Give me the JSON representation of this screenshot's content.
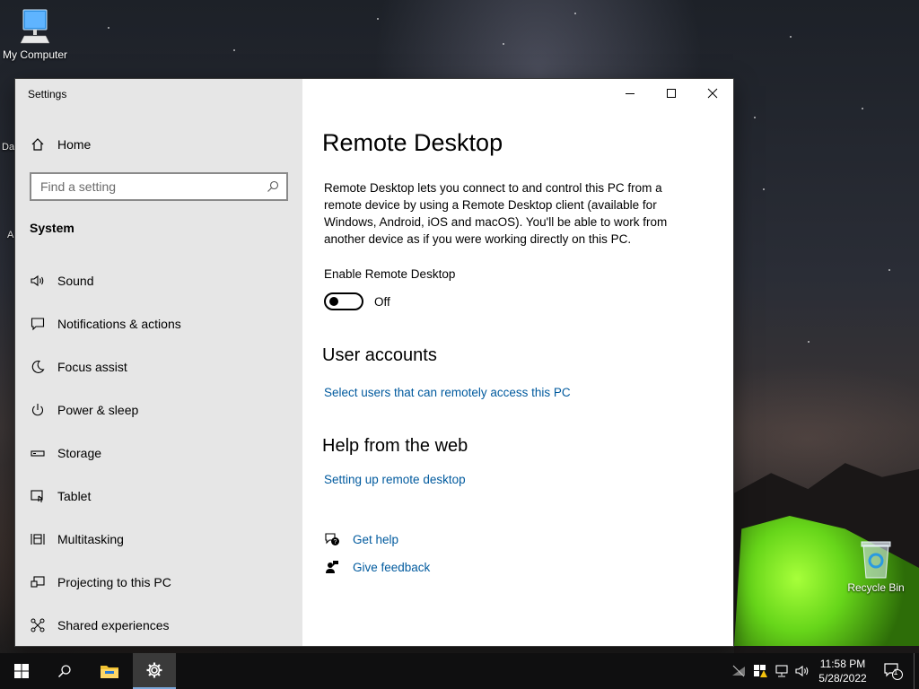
{
  "desktop": {
    "icons": [
      {
        "label": "My Computer"
      },
      {
        "label": "Recycle Bin"
      }
    ],
    "partial_label_1": "Da",
    "partial_label_2": "A"
  },
  "window": {
    "title": "Settings",
    "controls": {
      "minimize": "minimize-icon",
      "maximize": "maximize-icon",
      "close": "close-icon"
    }
  },
  "sidebar": {
    "home_label": "Home",
    "search_placeholder": "Find a setting",
    "section_label": "System",
    "items": [
      {
        "label": "Sound",
        "icon": "speaker-icon"
      },
      {
        "label": "Notifications & actions",
        "icon": "message-icon"
      },
      {
        "label": "Focus assist",
        "icon": "moon-icon"
      },
      {
        "label": "Power & sleep",
        "icon": "power-icon"
      },
      {
        "label": "Storage",
        "icon": "drive-icon"
      },
      {
        "label": "Tablet",
        "icon": "tablet-icon"
      },
      {
        "label": "Multitasking",
        "icon": "multitasking-icon"
      },
      {
        "label": "Projecting to this PC",
        "icon": "projector-icon"
      },
      {
        "label": "Shared experiences",
        "icon": "share-icon"
      }
    ]
  },
  "main": {
    "title": "Remote Desktop",
    "description": "Remote Desktop lets you connect to and control this PC from a remote device by using a Remote Desktop client (available for Windows, Android, iOS and macOS). You'll be able to work from another device as if you were working directly on this PC.",
    "enable_label": "Enable Remote Desktop",
    "toggle": {
      "state": "Off",
      "on": false
    },
    "user_accounts_heading": "User accounts",
    "user_accounts_link": "Select users that can remotely access this PC",
    "help_heading": "Help from the web",
    "help_link": "Setting up remote desktop",
    "get_help": "Get help",
    "give_feedback": "Give feedback"
  },
  "taskbar": {
    "clock_time": "11:58 PM",
    "clock_date": "5/28/2022",
    "notification_count": "1"
  },
  "colors": {
    "link": "#005a9e",
    "sidebar_bg": "#e6e6e6",
    "taskbar_bg": "#0f0f10"
  }
}
